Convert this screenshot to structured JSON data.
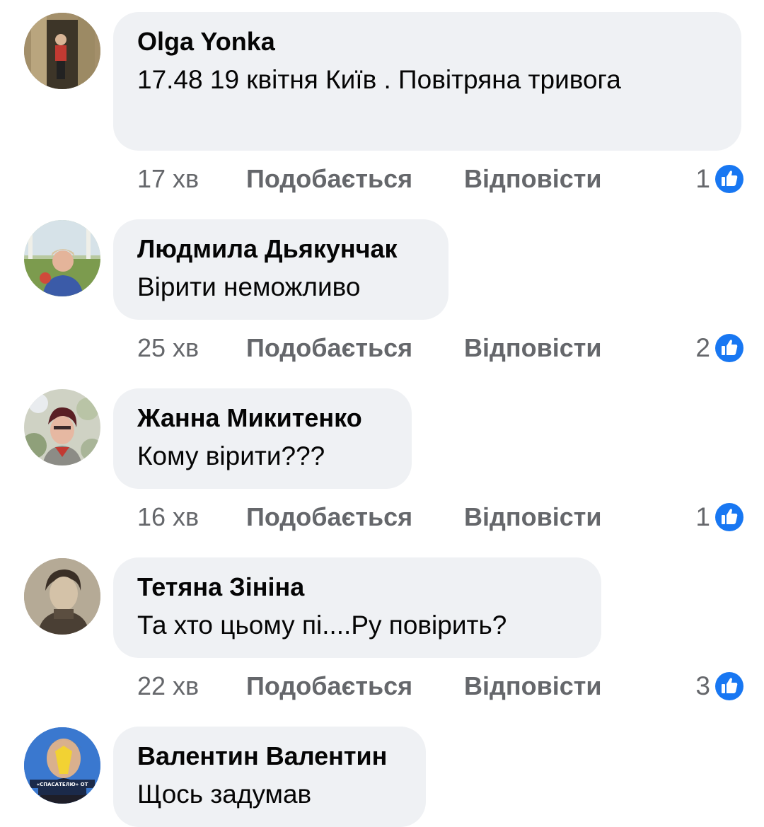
{
  "colors": {
    "bubble_bg": "#eff1f4",
    "meta_text": "#65676b",
    "like_blue": "#1877f2"
  },
  "comments": [
    {
      "author": "Olga Yonka",
      "text": "17.48 19 квітня Київ . Повітряна тривога",
      "time": "17 хв",
      "like_label": "Подобається",
      "reply_label": "Відповісти",
      "reaction_count": "1",
      "reaction_icon": "like-icon"
    },
    {
      "author": "Людмила Дьякунчак",
      "text": "Вірити неможливо",
      "time": "25 хв",
      "like_label": "Подобається",
      "reply_label": "Відповісти",
      "reaction_count": "2",
      "reaction_icon": "like-icon"
    },
    {
      "author": "Жанна Микитенко",
      "text": "Кому вірити???",
      "time": "16 хв",
      "like_label": "Подобається",
      "reply_label": "Відповісти",
      "reaction_count": "1",
      "reaction_icon": "like-icon"
    },
    {
      "author": "Тетяна Зініна",
      "text": "Та хто цьому пі....Ру повірить?",
      "time": "22 хв",
      "like_label": "Подобається",
      "reply_label": "Відповісти",
      "reaction_count": "3",
      "reaction_icon": "like-icon"
    },
    {
      "author": "Валентин Валентин",
      "text": "Щось задумав",
      "avatar_caption": "«СПАСАТЕЛЮ» ОТ"
    }
  ]
}
